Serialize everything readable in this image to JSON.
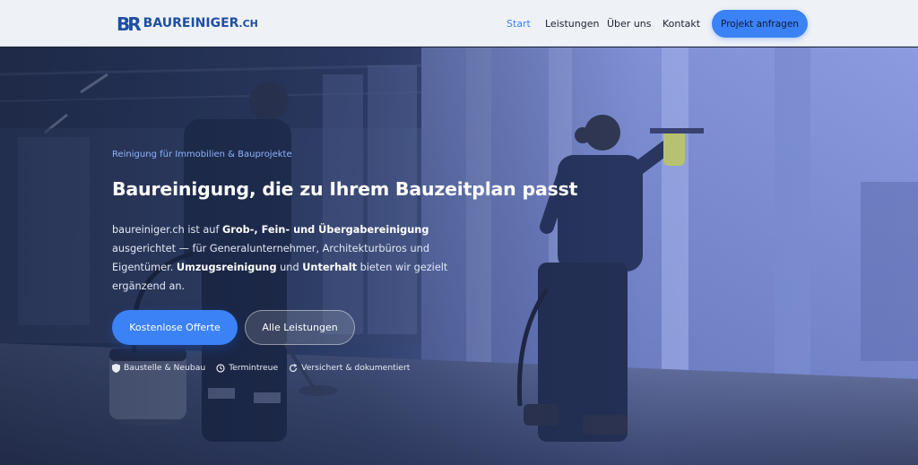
{
  "brand": {
    "mark": "BR",
    "name": "BAUREINIGER",
    "tld": ".CH"
  },
  "nav": {
    "items": [
      "Start",
      "Leistungen",
      "Über uns",
      "Kontakt"
    ],
    "cta": "Projekt anfragen",
    "active": "Start"
  },
  "hero": {
    "eyebrow": "Reinigung für Immobilien & Bauprojekte",
    "headline": "Baureinigung, die zu Ihrem Bauzeitplan passt",
    "lead": {
      "p1": "baureiniger.ch ist auf ",
      "b1": "Grob-, Fein- und Übergabereinigung",
      "p2": " ausgerichtet — für Generalunternehmer, Architekturbüros und Eigentümer. ",
      "b2": "Umzugsreinigung",
      "p3": " und ",
      "b3": "Unterhalt",
      "p4": " bieten wir gezielt ergänzend an."
    },
    "primary_button": "Kostenlose Offerte",
    "secondary_button": "Alle Leistungen",
    "badges": [
      {
        "icon": "shield-icon",
        "label": "Baustelle & Neubau"
      },
      {
        "icon": "clock-icon",
        "label": "Termintreue"
      },
      {
        "icon": "refresh-icon",
        "label": "Versichert & dokumentiert"
      }
    ],
    "worker_shirt_print": "baureiniger.ch"
  },
  "colors": {
    "accent": "#3b82f6",
    "brand": "#1f4fa3",
    "header_bg": "#eef1f6"
  }
}
